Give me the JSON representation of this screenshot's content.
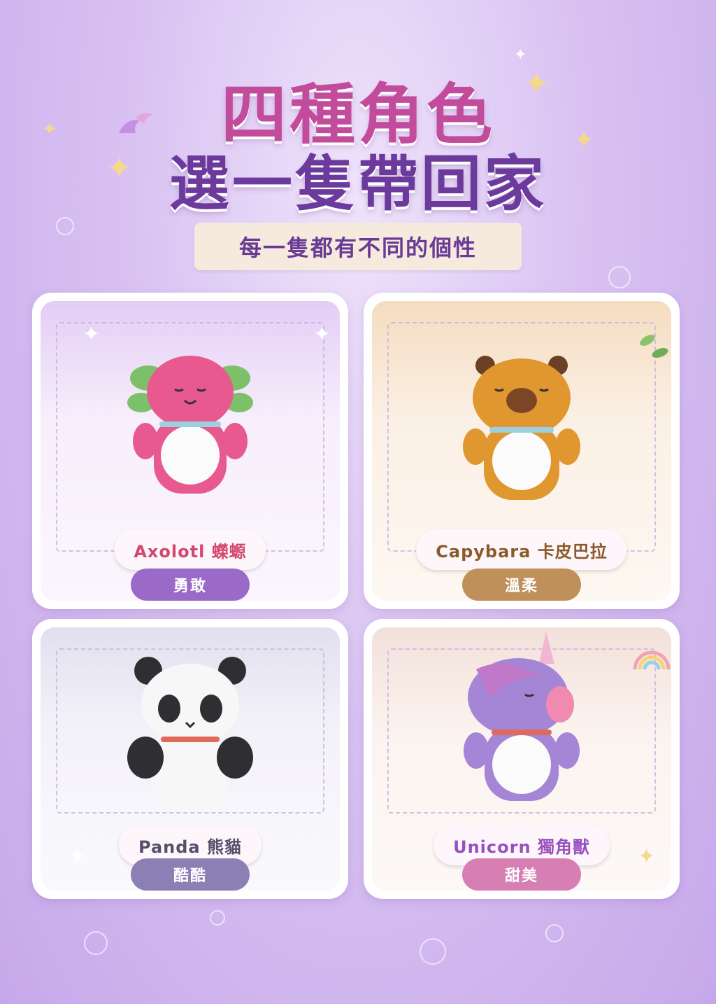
{
  "header": {
    "title_line1": "四種角色",
    "title_line2": "選一隻帶回家",
    "subtitle": "每一隻都有不同的個性"
  },
  "cards": [
    {
      "name": "Axolotl 蠑螈",
      "trait": "勇敢",
      "name_color": "#d4486f",
      "trait_color": "#9b69c8"
    },
    {
      "name": "Capybara 卡皮巴拉",
      "trait": "溫柔",
      "name_color": "#8a5a2a",
      "trait_color": "#c0905a"
    },
    {
      "name": "Panda 熊貓",
      "trait": "酷酷",
      "name_color": "#55506a",
      "trait_color": "#8c7fb3"
    },
    {
      "name": "Unicorn 獨角獸",
      "trait": "甜美",
      "name_color": "#9a4fc0",
      "trait_color": "#d77fb5"
    }
  ],
  "icons": [
    "sparkle-icon",
    "bubble-icon",
    "leaf-icon",
    "rainbow-icon"
  ]
}
